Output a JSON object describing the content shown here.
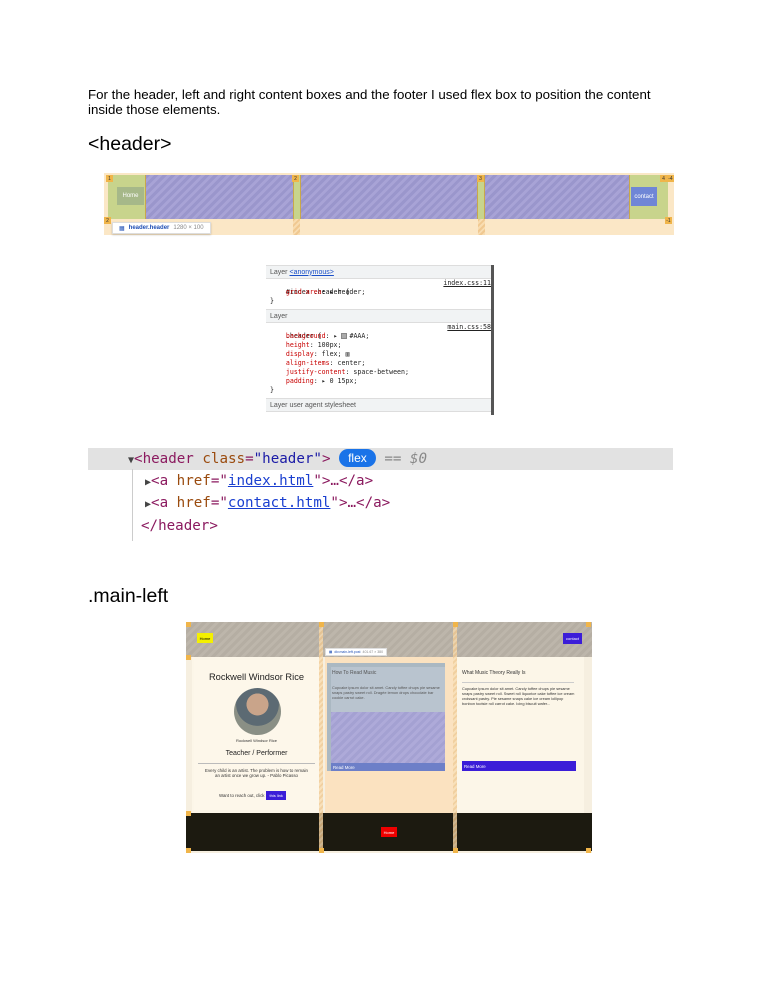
{
  "intro_text": "For the header, left and right content boxes and the footer I used flex box to position the content inside those elements.",
  "section_header_title": "<header>",
  "section_mainleft_title": ".main-left",
  "header_shot": {
    "home_label": "Home",
    "contact_label": "contact",
    "tag_name": "header.header",
    "tag_dims": "1280 × 100",
    "line_numbers": [
      "1",
      "2",
      "3",
      "4",
      "-4",
      "2",
      "-1"
    ]
  },
  "css_panel": {
    "layer1_prefix": "Layer",
    "layer1_link": "<anonymous>",
    "rule1_selector": "#index .header {",
    "rule1_file": "index.css:11",
    "rule1_decl_prop": "grid-area",
    "rule1_decl_val": "header;",
    "close1": "}",
    "layer2": "Layer",
    "rule2_selector": ".header {",
    "rule2_file": "main.css:58",
    "rule2_decls": [
      {
        "prop": "background",
        "val": "#AAA;"
      },
      {
        "prop": "height",
        "val": "100px;"
      },
      {
        "prop": "display",
        "val": "flex;"
      },
      {
        "prop": "align-items",
        "val": "center;"
      },
      {
        "prop": "justify-content",
        "val": "space-between;"
      },
      {
        "prop": "padding",
        "val": "0 15px;"
      }
    ],
    "close2": "}",
    "layer3": "Layer user agent stylesheet"
  },
  "elements_panel": {
    "open_tag": "header",
    "class_attr": "class",
    "class_val": "\"header\"",
    "badge": "flex",
    "eq": "== $0",
    "child1_href": "index.html",
    "child2_href": "contact.html",
    "ellipsis": ">…</a>",
    "close_tag": "</header>"
  },
  "mainleft_shot": {
    "home_label": "Home",
    "contact_label": "contact",
    "tag_name": "div.main-left.post",
    "tag_dims": "401.67 × 380",
    "profile_name": "Rockwell Windsor Rice",
    "profile_caption": "Rockwell Windsor Rice",
    "role": "Teacher / Performer",
    "quote": "Every child is an artist. The problem is how to remain an artist once we grow up. - Pablo Picasso",
    "reach_text": "Want to reach out, click",
    "reach_link": "this link",
    "post1_title": "How To Read Music",
    "post1_body": "Cupcake ipsum dolor sit amet. Candy toffee chups pie sesame snaps pastry sweet roll. Dragée lemon drops chocolate bar cookie carrot cake.",
    "post1_more": "Read More",
    "post2_title": "What Music Theory Really Is",
    "post2_body": "Cupcake ipsum dolor sit amet. Candy toffee chups pie sesame snaps pastry sweet roll. Sweet roll liquorice cake toffee ice cream croissant pastry. Pie sesame snaps cake ice cream lollipop bonbon tootsie roll carrot cake. Icing biscuit wafer...",
    "post2_more": "Read More",
    "footer_home": "Home"
  }
}
